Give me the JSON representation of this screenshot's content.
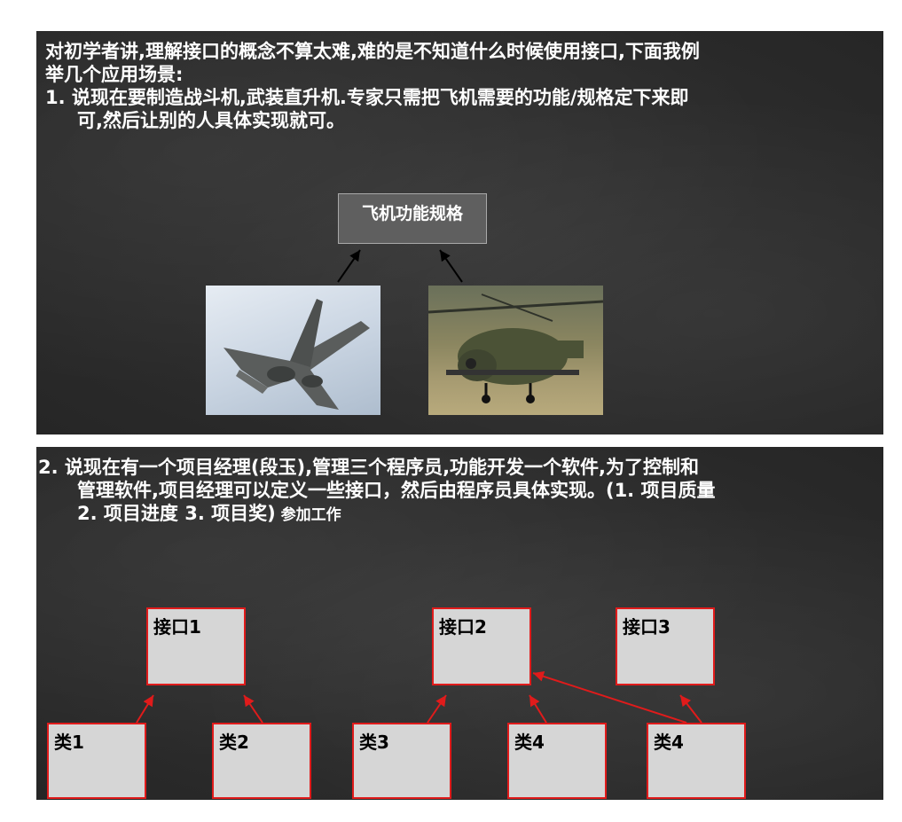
{
  "section1": {
    "intro": "对初学者讲,理解接口的概念不算太难,难的是不知道什么时候使用接口,下面我例",
    "intro2": "举几个应用场景:",
    "item_line1": "1.  说现在要制造战斗机,武装直升机.专家只需把飞机需要的功能/规格定下来即",
    "item_line2": "可,然后让别的人具体实现就可。",
    "spec_box": "飞机功能规格"
  },
  "section2": {
    "line1": "2.  说现在有一个项目经理(段玉),管理三个程序员,功能开发一个软件,为了控制和",
    "line2": "管理软件,项目经理可以定义一些接口，然后由程序员具体实现。(1. 项目质量",
    "line3": "2. 项目进度 3. 项目奖)",
    "line3_small": " 参加工作",
    "interfaces": [
      "接口1",
      "接口2",
      "接口3"
    ],
    "classes": [
      "类1",
      "类2",
      "类3",
      "类4",
      "类4"
    ]
  },
  "colors": {
    "board": "#2b2b2b",
    "box_border": "#e01b1b",
    "box_fill": "#d6d6d6",
    "spec_fill": "#5f5f5f"
  }
}
